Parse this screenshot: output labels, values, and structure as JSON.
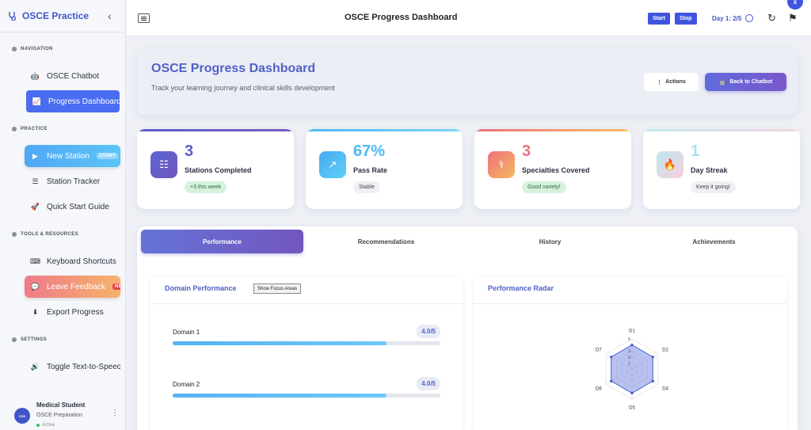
{
  "sidebar": {
    "brand": "OSCE Practice",
    "sections": {
      "navigation": "NAVIGATION",
      "practice": "PRACTICE",
      "tools": "TOOLS & RESOURCES",
      "settings": "SETTINGS"
    },
    "items": {
      "chatbot": "OSCE Chatbot",
      "dashboard": "Progress Dashboard",
      "new_station": "New Station",
      "new_station_tag": "START",
      "tracker": "Station Tracker",
      "guide": "Quick Start Guide",
      "shortcuts": "Keyboard Shortcuts",
      "feedback": "Leave Feedback",
      "feedback_tag": "NEW",
      "export": "Export Progress",
      "tts": "Toggle Text-to-Speech"
    },
    "user": {
      "name": "Medical Student",
      "role": "OSCE Preparation",
      "status": "Active",
      "avatar_text": "CSD"
    }
  },
  "topbar": {
    "title": "OSCE Progress Dashboard",
    "start": "Start",
    "stop": "Stop",
    "day": "Day 1: 2/5",
    "close": "x"
  },
  "hero": {
    "title": "OSCE Progress Dashboard",
    "subtitle": "Track your learning journey and clinical skills development",
    "actions": "Actions",
    "back": "Back to Chatbot"
  },
  "stats": [
    {
      "value": "3",
      "label": "Stations Completed",
      "pill": "+3 this week",
      "color": "#5b5fc7"
    },
    {
      "value": "67%",
      "label": "Pass Rate",
      "pill": "Stable",
      "color": "#4db8f3"
    },
    {
      "value": "3",
      "label": "Specialties Covered",
      "pill": "Good variety!",
      "color": "#ee6f7c"
    },
    {
      "value": "1",
      "label": "Day Streak",
      "pill": "Keep it going!",
      "color": "#a8e0ec"
    }
  ],
  "tabs": [
    "Performance",
    "Recommendations",
    "History",
    "Achievements"
  ],
  "domain_performance": {
    "title": "Domain Performance",
    "focus_button": "Show Focus Areas",
    "domains": [
      {
        "name": "Domain 1",
        "score": "4.0/5",
        "fraction": 0.8
      },
      {
        "name": "Domain 2",
        "score": "4.0/5",
        "fraction": 0.8
      }
    ]
  },
  "radar": {
    "title": "Performance Radar",
    "axes": [
      "D1",
      "D2",
      "D4",
      "D5",
      "D6",
      "D7"
    ],
    "ticks": [
      "5",
      "3",
      "2",
      "1"
    ],
    "values": [
      4,
      4,
      4,
      4,
      4,
      4
    ],
    "max": 5
  }
}
